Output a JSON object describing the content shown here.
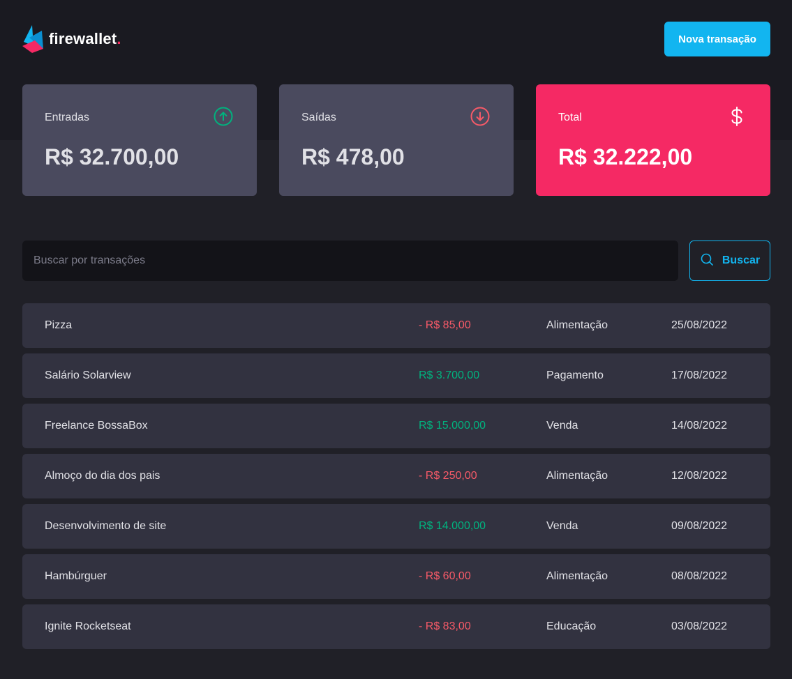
{
  "header": {
    "logo_text": "firewallet",
    "logo_dot": ".",
    "new_transaction_label": "Nova transação"
  },
  "summary": {
    "income": {
      "label": "Entradas",
      "value": "R$ 32.700,00",
      "icon": "arrow-circle-up-icon",
      "color": "#00b37e"
    },
    "outcome": {
      "label": "Saídas",
      "value": "R$ 478,00",
      "icon": "arrow-circle-down-icon",
      "color": "#f75a68"
    },
    "total": {
      "label": "Total",
      "value": "R$ 32.222,00",
      "icon": "currency-dollar-icon",
      "color": "#f52964"
    }
  },
  "search": {
    "placeholder": "Buscar por transações",
    "button_label": "Buscar"
  },
  "transactions": [
    {
      "description": "Pizza",
      "price": "- R$ 85,00",
      "type": "outcome",
      "category": "Alimentação",
      "date": "25/08/2022"
    },
    {
      "description": "Salário Solarview",
      "price": "R$ 3.700,00",
      "type": "income",
      "category": "Pagamento",
      "date": "17/08/2022"
    },
    {
      "description": "Freelance BossaBox",
      "price": "R$ 15.000,00",
      "type": "income",
      "category": "Venda",
      "date": "14/08/2022"
    },
    {
      "description": "Almoço do dia dos pais",
      "price": "- R$ 250,00",
      "type": "outcome",
      "category": "Alimentação",
      "date": "12/08/2022"
    },
    {
      "description": "Desenvolvimento de site",
      "price": "R$ 14.000,00",
      "type": "income",
      "category": "Venda",
      "date": "09/08/2022"
    },
    {
      "description": "Hambúrguer",
      "price": "- R$ 60,00",
      "type": "outcome",
      "category": "Alimentação",
      "date": "08/08/2022"
    },
    {
      "description": "Ignite Rocketseat",
      "price": "- R$ 83,00",
      "type": "outcome",
      "category": "Educação",
      "date": "03/08/2022"
    }
  ],
  "colors": {
    "accent": "#12b5f0",
    "brand": "#f52964",
    "income": "#00b37e",
    "outcome": "#f75a68"
  }
}
